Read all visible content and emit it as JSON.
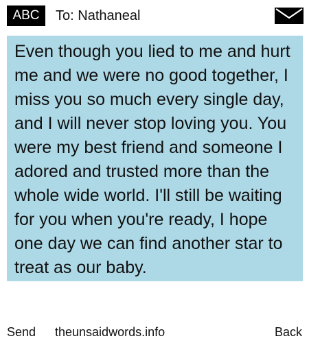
{
  "header": {
    "mode_badge": "ABC",
    "to_label": "To:",
    "recipient": "Nathaneal",
    "envelope_icon": "envelope-icon"
  },
  "message": {
    "text": "Even though you lied to me and hurt me and we were no good together, I miss you so much every single day, and I will never stop loving you. You were my best friend and someone I adored and trusted more than the whole wide world. I'll still be waiting for you when you're ready, I hope one day we can find another star to treat as our baby.",
    "highlight_color": "#ADD8E6"
  },
  "footer": {
    "left_softkey": "Send",
    "site": "theunsaidwords.info",
    "right_softkey": "Back"
  }
}
